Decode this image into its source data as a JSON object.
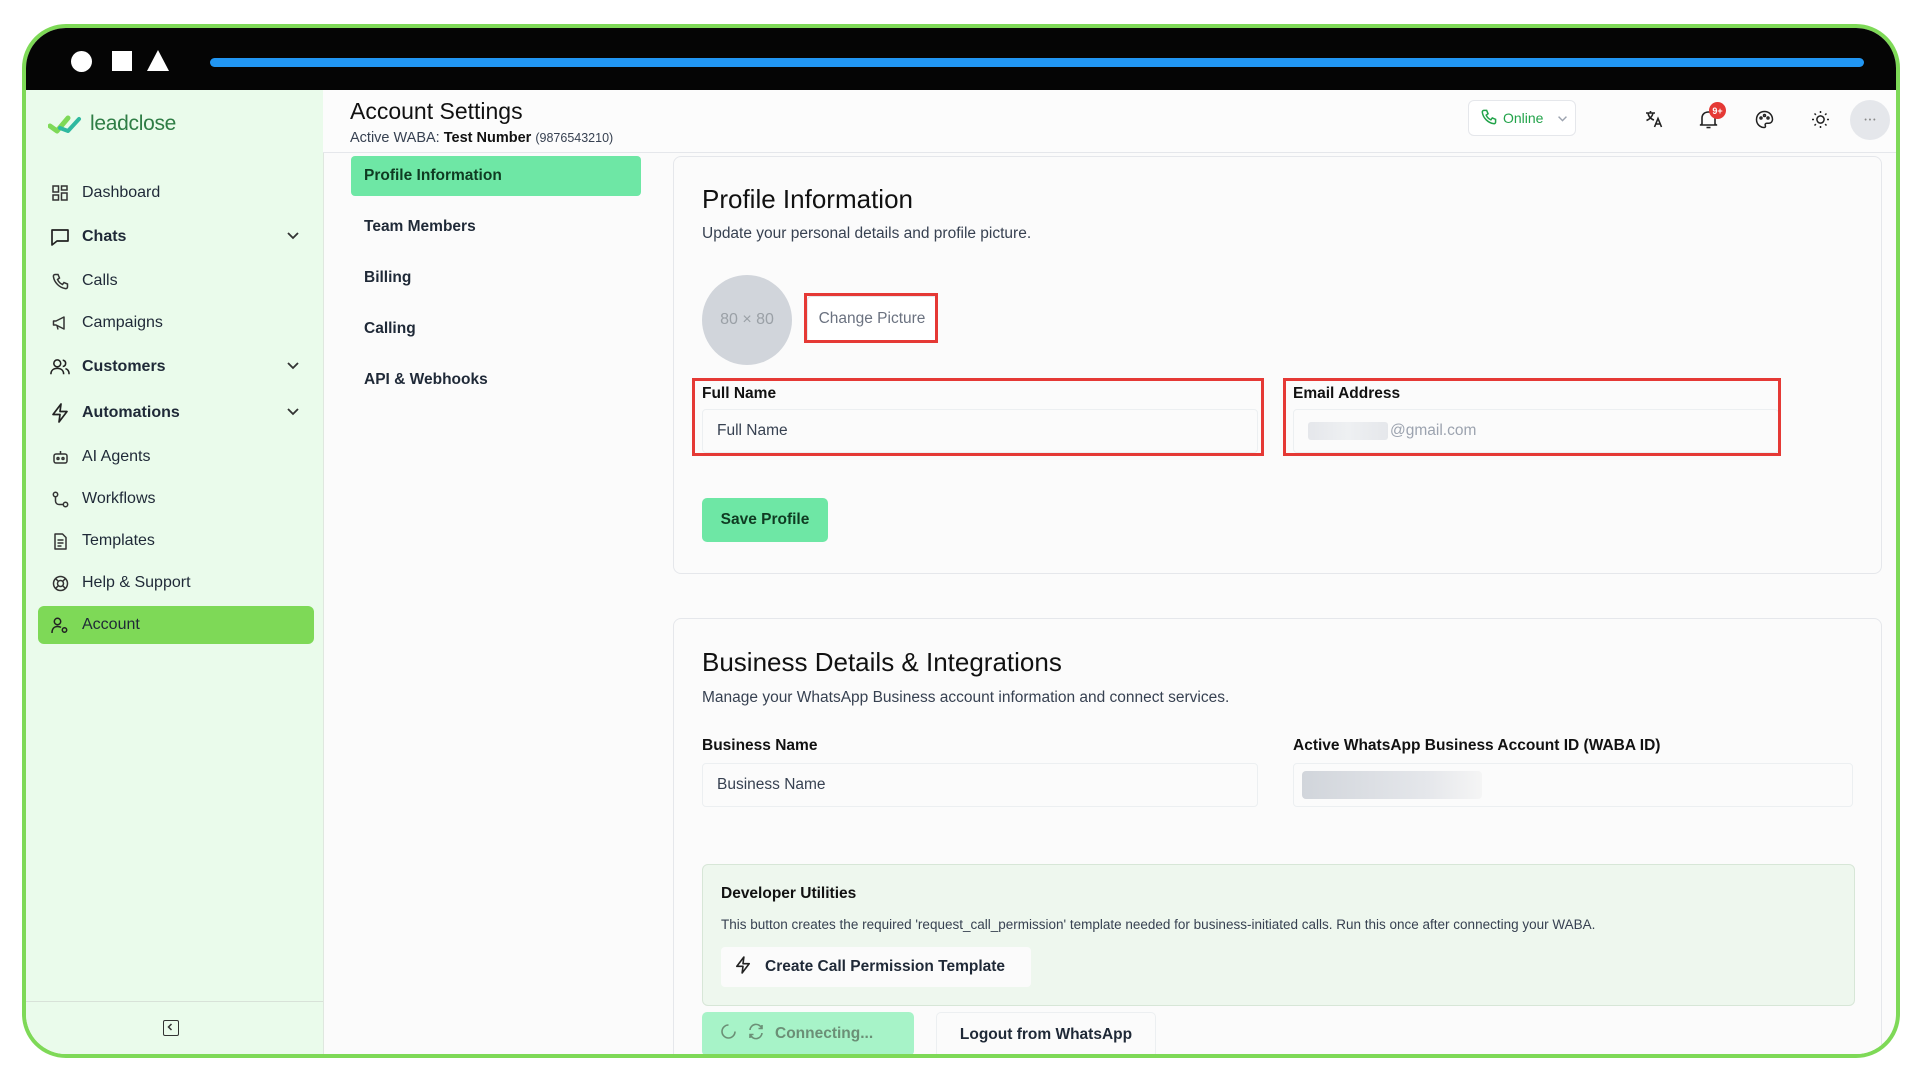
{
  "brand": {
    "name": "leadclose",
    "color": "#2f7d45"
  },
  "sidebar": {
    "items": [
      {
        "label": "Dashboard",
        "icon": "dashboard-icon"
      },
      {
        "label": "Chats",
        "icon": "chat-icon",
        "expandable": true
      },
      {
        "label": "Calls",
        "icon": "phone-icon"
      },
      {
        "label": "Campaigns",
        "icon": "megaphone-icon"
      },
      {
        "label": "Customers",
        "icon": "users-icon",
        "expandable": true
      },
      {
        "label": "Automations",
        "icon": "bolt-icon",
        "expandable": true
      },
      {
        "label": "AI Agents",
        "icon": "bot-icon"
      },
      {
        "label": "Workflows",
        "icon": "workflow-icon"
      },
      {
        "label": "Templates",
        "icon": "document-icon"
      },
      {
        "label": "Help & Support",
        "icon": "lifebuoy-icon"
      },
      {
        "label": "Account",
        "icon": "user-cog-icon",
        "active": true
      }
    ]
  },
  "header": {
    "title": "Account Settings",
    "waba_prefix": "Active WABA:",
    "waba_name": "Test Number",
    "waba_number": "(9876543210)",
    "status": "Online",
    "notification_badge": "9+"
  },
  "settings_menu": {
    "items": [
      {
        "label": "Profile Information",
        "active": true
      },
      {
        "label": "Team Members"
      },
      {
        "label": "Billing"
      },
      {
        "label": "Calling"
      },
      {
        "label": "API & Webhooks"
      }
    ]
  },
  "profile": {
    "title": "Profile Information",
    "subtitle": "Update your personal details and profile picture.",
    "avatar_placeholder": "80 × 80",
    "change_picture": "Change Picture",
    "full_name_label": "Full Name",
    "full_name_placeholder": "Full Name",
    "email_label": "Email Address",
    "email_value": "@gmail.com",
    "save": "Save Profile"
  },
  "business": {
    "title": "Business Details & Integrations",
    "subtitle": "Manage your WhatsApp Business account information and connect services.",
    "business_name_label": "Business Name",
    "business_name_placeholder": "Business Name",
    "waba_id_label": "Active WhatsApp Business Account ID (WABA ID)",
    "dev_title": "Developer Utilities",
    "dev_text": "This button creates the required 'request_call_permission' template needed for business-initiated calls. Run this once after connecting your WABA.",
    "dev_button": "Create Call Permission Template",
    "connecting": "Connecting...",
    "logout": "Logout from WhatsApp"
  },
  "colors": {
    "accent": "#7ed957",
    "primary_button": "#6ee7a5",
    "highlight": "#e53935",
    "progress_bar": "#2196f3"
  }
}
